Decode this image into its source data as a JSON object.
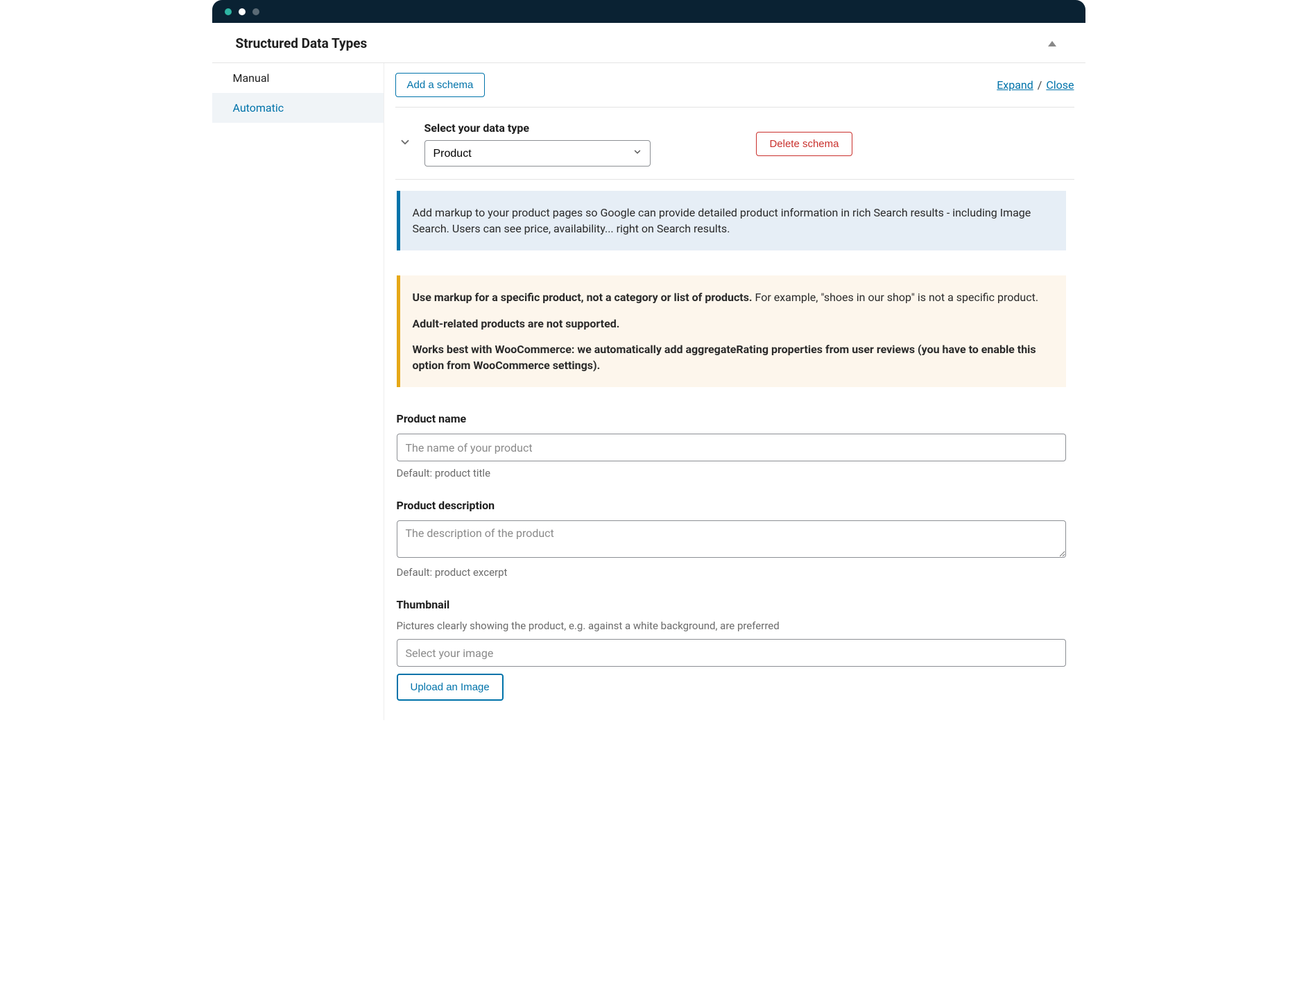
{
  "panel": {
    "title": "Structured Data Types"
  },
  "sidebar": {
    "items": [
      {
        "label": "Manual"
      },
      {
        "label": "Automatic"
      }
    ]
  },
  "toolbar": {
    "add_label": "Add a schema",
    "expand_label": "Expand",
    "close_label": "Close",
    "separator": " / "
  },
  "schema": {
    "select_label": "Select your data type",
    "selected": "Product",
    "delete_label": "Delete schema"
  },
  "notices": {
    "info": "Add markup to your product pages so Google can provide detailed product information in rich Search results - including Image Search. Users can see price, availability... right on Search results.",
    "warn_1_bold": "Use markup for a specific product, not a category or list of products.",
    "warn_1_rest": " For example, \"shoes in our shop\" is not a specific product.",
    "warn_2": "Adult-related products are not supported.",
    "warn_3": "Works best with WooCommerce: we automatically add aggregateRating properties from user reviews (you have to enable this option from WooCommerce settings)."
  },
  "fields": {
    "name": {
      "label": "Product name",
      "placeholder": "The name of your product",
      "hint": "Default: product title"
    },
    "description": {
      "label": "Product description",
      "placeholder": "The description of the product",
      "hint": "Default: product excerpt"
    },
    "thumbnail": {
      "label": "Thumbnail",
      "sublabel": "Pictures clearly showing the product, e.g. against a white background, are preferred",
      "placeholder": "Select your image",
      "upload_label": "Upload an Image"
    }
  }
}
